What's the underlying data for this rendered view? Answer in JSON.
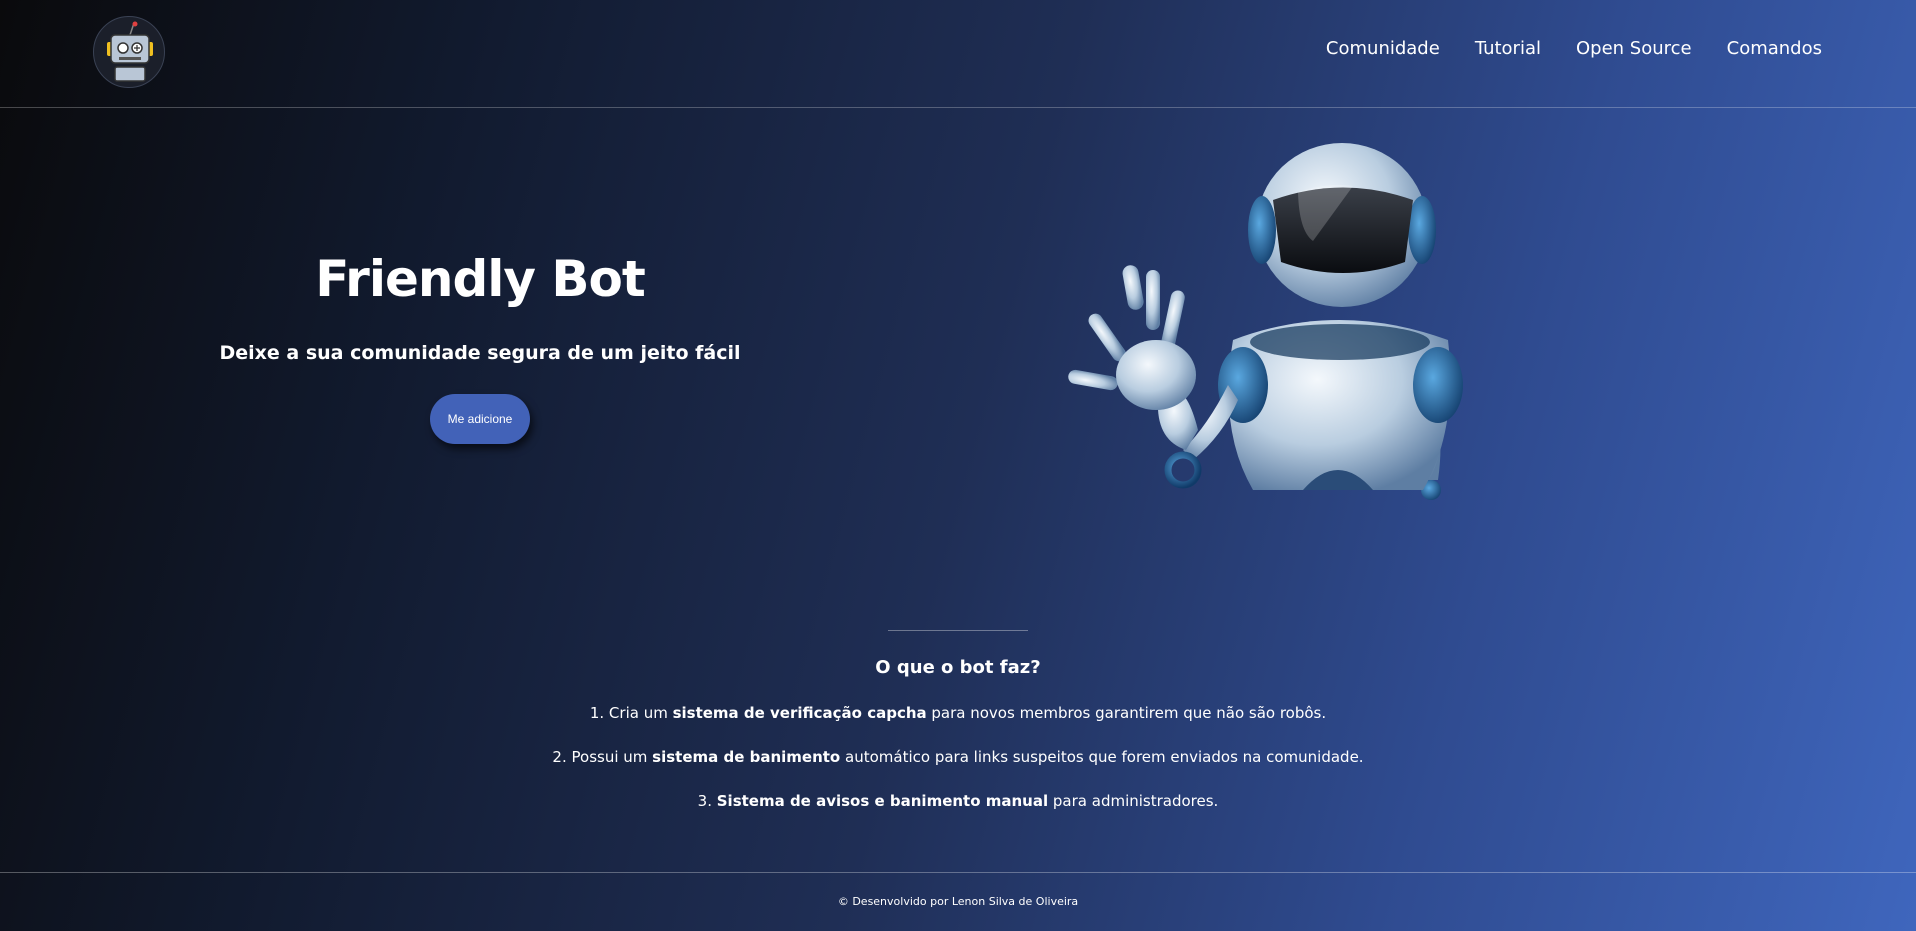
{
  "header": {
    "logo_icon": "robot-logo-icon",
    "nav": [
      {
        "label": "Comunidade"
      },
      {
        "label": "Tutorial"
      },
      {
        "label": "Open Source"
      },
      {
        "label": "Comandos"
      }
    ]
  },
  "hero": {
    "title": "Friendly Bot",
    "subtitle": "Deixe a sua comunidade segura de um jeito fácil",
    "cta_label": "Me adicione",
    "image_icon": "waving-robot-illustration"
  },
  "features": {
    "title": "O que o bot faz?",
    "items": [
      {
        "prefix": "1. Cria um ",
        "bold": "sistema de verificação capcha",
        "suffix": " para novos membros garantirem que não são robôs."
      },
      {
        "prefix": "2. Possui um ",
        "bold": "sistema de banimento",
        "suffix": " automático para links suspeitos que forem enviados na comunidade."
      },
      {
        "prefix": "3. ",
        "bold": "Sistema de avisos e banimento manual",
        "suffix": " para administradores."
      }
    ]
  },
  "footer": {
    "text": "© Desenvolvido por Lenon Silva de Oliveira"
  },
  "colors": {
    "accent": "#4262b8",
    "gradient_start": "#0a0a0c",
    "gradient_end": "#3f66bd"
  }
}
